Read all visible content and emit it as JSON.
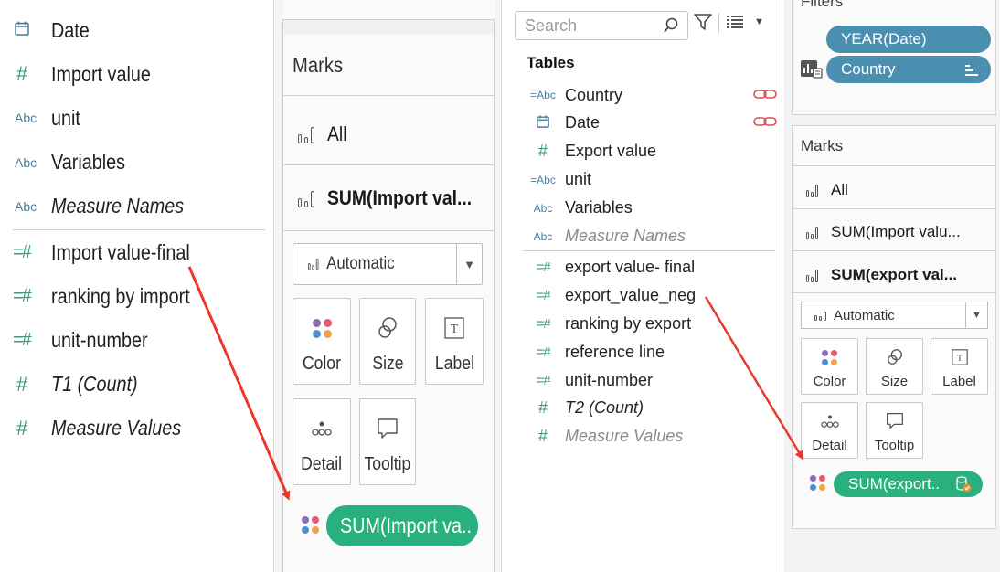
{
  "field_list": {
    "items": [
      {
        "icon": "calendar-icon",
        "glyph": "📅",
        "kind": "cal",
        "label": "Date",
        "italic": false
      },
      {
        "icon": "number-icon",
        "glyph": "#",
        "kind": "hash",
        "label": "Import value",
        "italic": false
      },
      {
        "icon": "string-icon",
        "glyph": "Abc",
        "kind": "abc",
        "label": "unit",
        "italic": false
      },
      {
        "icon": "string-icon",
        "glyph": "Abc",
        "kind": "abc",
        "label": "Variables",
        "italic": false
      },
      {
        "icon": "string-icon",
        "glyph": "Abc",
        "kind": "abc",
        "label": "Measure Names",
        "italic": true
      },
      {
        "icon": "calculated-number-icon",
        "glyph": "=#",
        "kind": "calc",
        "label": "Import value-final",
        "italic": false
      },
      {
        "icon": "calculated-number-icon",
        "glyph": "=#",
        "kind": "calc",
        "label": "ranking by import",
        "italic": false
      },
      {
        "icon": "calculated-number-icon",
        "glyph": "=#",
        "kind": "calc",
        "label": "unit-number",
        "italic": false
      },
      {
        "icon": "number-icon",
        "glyph": "#",
        "kind": "hash",
        "label": "T1 (Count)",
        "italic": true
      },
      {
        "icon": "number-icon",
        "glyph": "#",
        "kind": "hash",
        "label": "Measure Values",
        "italic": true
      }
    ]
  },
  "marks_left": {
    "title": "Marks",
    "shelves": [
      {
        "label": "All",
        "bold": false
      },
      {
        "label": "SUM(Import val...",
        "bold": true
      }
    ],
    "mark_type": "Automatic",
    "tiles": [
      "Color",
      "Size",
      "Label",
      "Detail",
      "Tooltip"
    ],
    "color_pill": "SUM(Import va.."
  },
  "data_pane": {
    "search_placeholder": "Search",
    "section": "Tables",
    "items": [
      {
        "icon": "string-key-icon",
        "glyph": "=Abc",
        "kind": "abc",
        "label": "Country",
        "style": "normal",
        "link": true
      },
      {
        "icon": "calendar-icon",
        "glyph": "📅",
        "kind": "cal",
        "label": "Date",
        "style": "normal",
        "link": true
      },
      {
        "icon": "number-icon",
        "glyph": "#",
        "kind": "hash",
        "label": "Export value",
        "style": "normal",
        "link": false
      },
      {
        "icon": "string-key-icon",
        "glyph": "=Abc",
        "kind": "abc",
        "label": "unit",
        "style": "normal",
        "link": false
      },
      {
        "icon": "string-icon",
        "glyph": "Abc",
        "kind": "abc",
        "label": "Variables",
        "style": "normal",
        "link": false
      },
      {
        "icon": "string-icon",
        "glyph": "Abc",
        "kind": "abc",
        "label": "Measure Names",
        "style": "muted",
        "link": false
      },
      {
        "icon": "calculated-number-icon",
        "glyph": "=#",
        "kind": "calc",
        "label": "export value- final",
        "style": "normal",
        "link": false
      },
      {
        "icon": "calculated-number-icon",
        "glyph": "=#",
        "kind": "calc",
        "label": "export_value_neg",
        "style": "normal",
        "link": false
      },
      {
        "icon": "calculated-number-icon",
        "glyph": "=#",
        "kind": "calc",
        "label": "ranking by export",
        "style": "normal",
        "link": false
      },
      {
        "icon": "calculated-number-icon",
        "glyph": "=#",
        "kind": "calc",
        "label": "reference line",
        "style": "normal",
        "link": false
      },
      {
        "icon": "calculated-number-icon",
        "glyph": "=#",
        "kind": "calc",
        "label": "unit-number",
        "style": "normal",
        "link": false
      },
      {
        "icon": "number-icon",
        "glyph": "#",
        "kind": "hash",
        "label": "T2 (Count)",
        "style": "italic",
        "link": false
      },
      {
        "icon": "number-icon",
        "glyph": "#",
        "kind": "hash",
        "label": "Measure Values",
        "style": "muted",
        "link": false
      }
    ],
    "link_glyph": "⊖⊖"
  },
  "right_panel": {
    "filters_title": "Filters",
    "filters": [
      {
        "label": "YEAR(Date)",
        "icon": ""
      },
      {
        "label": "Country",
        "icon": "sort-icon"
      }
    ],
    "marks_title": "Marks",
    "shelves": [
      {
        "label": "All",
        "bold": false
      },
      {
        "label": "SUM(Import valu...",
        "bold": false
      },
      {
        "label": "SUM(export val...",
        "bold": true
      }
    ],
    "mark_type": "Automatic",
    "tiles": [
      "Color",
      "Size",
      "Label",
      "Detail",
      "Tooltip"
    ],
    "color_pill": "SUM(export.."
  },
  "colors": {
    "pill_green": "#28b07f",
    "filter_blue": "#4a8eb0",
    "arrow_red": "#e8392b",
    "dim_icon": "#4a7f9a",
    "measure_icon": "#3a9b7b"
  }
}
